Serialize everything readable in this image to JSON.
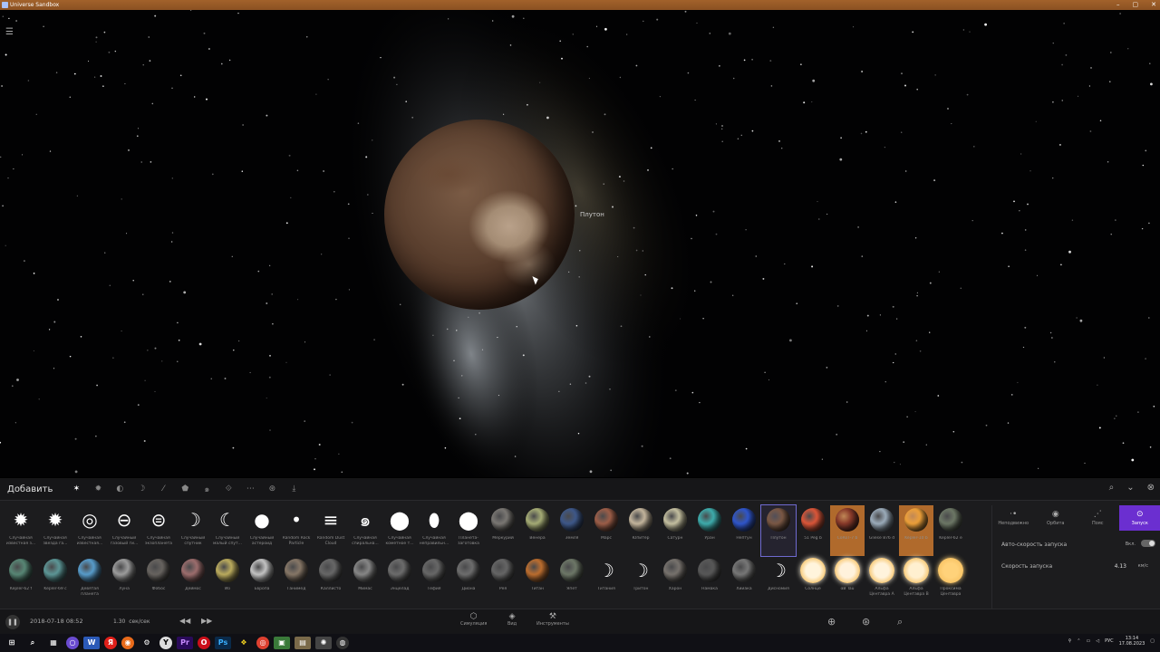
{
  "window": {
    "title": "Universe Sandbox",
    "min": "–",
    "max": "▢",
    "close": "✕"
  },
  "scene": {
    "planet_label": "Плутон"
  },
  "panel": {
    "add_label": "Добавить",
    "row1": [
      {
        "label": "Случайная известная з...",
        "kind": "glyph",
        "glyph": "✹"
      },
      {
        "label": "Случайная звезда га...",
        "kind": "glyph",
        "glyph": "✹"
      },
      {
        "label": "Случайная известная...",
        "kind": "glyph",
        "glyph": "◎"
      },
      {
        "label": "Случайный газовый ги...",
        "kind": "glyph",
        "glyph": "⊖"
      },
      {
        "label": "Случайная экзопланета",
        "kind": "glyph",
        "glyph": "⊜"
      },
      {
        "label": "Случайный спутник",
        "kind": "glyph",
        "glyph": "☽"
      },
      {
        "label": "Случайный малый спут...",
        "kind": "glyph",
        "glyph": "☾"
      },
      {
        "label": "Случайный астероид",
        "kind": "glyph",
        "glyph": "●"
      },
      {
        "label": "Random Rock Particle",
        "kind": "glyph",
        "glyph": "•"
      },
      {
        "label": "Random Dust Cloud",
        "kind": "glyph",
        "glyph": "≡"
      },
      {
        "label": "Случайная спиральна...",
        "kind": "glyph",
        "glyph": "๑"
      },
      {
        "label": "Случайная кометное т...",
        "kind": "glyph",
        "glyph": "⬤"
      },
      {
        "label": "Случайная неправильн...",
        "kind": "glyph",
        "glyph": "⬮"
      },
      {
        "label": "Планета-заготовка",
        "kind": "glyph",
        "glyph": "⬤"
      },
      {
        "label": "Меркурий",
        "kind": "ball",
        "color": "#7d7a76"
      },
      {
        "label": "Венера",
        "kind": "ball",
        "color": "#a9b078"
      },
      {
        "label": "Земля",
        "kind": "ball",
        "color": "#3f5a8c"
      },
      {
        "label": "Марс",
        "kind": "ball",
        "color": "#a0604a"
      },
      {
        "label": "Юпитер",
        "kind": "ball",
        "color": "#c8b9a0"
      },
      {
        "label": "Сатурн",
        "kind": "ball",
        "color": "#c9c4a4"
      },
      {
        "label": "Уран",
        "kind": "ball",
        "color": "#3fb0b0"
      },
      {
        "label": "Нептун",
        "kind": "ball",
        "color": "#3058d0"
      },
      {
        "label": "Плутон",
        "kind": "ball",
        "color": "#7d5a46",
        "selected": true
      },
      {
        "label": "51 Peg b",
        "kind": "ball",
        "color": "#e0583a"
      },
      {
        "label": "CoRoT-7 b",
        "kind": "ball",
        "color": "#8a3a2a",
        "highlight": true
      },
      {
        "label": "Gliese 876 d",
        "kind": "ball",
        "color": "#9fb0bf"
      },
      {
        "label": "Kepler-10 b",
        "kind": "ball",
        "color": "#f0a23a",
        "highlight": true
      },
      {
        "label": "Kepler-62 e",
        "kind": "ball",
        "color": "#6f7a68"
      }
    ],
    "row2": [
      {
        "label": "Kepler-62 f",
        "kind": "ball",
        "color": "#5a8a78"
      },
      {
        "label": "Kepler-69 c",
        "kind": "ball",
        "color": "#5f9a9a"
      },
      {
        "label": "Девятая планета",
        "kind": "ball",
        "color": "#5aa0d0"
      },
      {
        "label": "Луна",
        "kind": "ball",
        "color": "#a0a0a0"
      },
      {
        "label": "Фобос",
        "kind": "ball",
        "color": "#6a6662"
      },
      {
        "label": "Деймос",
        "kind": "ball",
        "color": "#a07070"
      },
      {
        "label": "Ио",
        "kind": "ball",
        "color": "#c0b060"
      },
      {
        "label": "Европа",
        "kind": "ball",
        "color": "#c8c8c8"
      },
      {
        "label": "Ганимед",
        "kind": "ball",
        "color": "#8a7a6a"
      },
      {
        "label": "Каллисто",
        "kind": "ball",
        "color": "#6a6a6a"
      },
      {
        "label": "Мимас",
        "kind": "ball",
        "color": "#8a8a8a"
      },
      {
        "label": "Энцелад",
        "kind": "ball",
        "color": "#6f6f6f"
      },
      {
        "label": "Тефия",
        "kind": "ball",
        "color": "#6a6a6a"
      },
      {
        "label": "Диона",
        "kind": "ball",
        "color": "#707070"
      },
      {
        "label": "Рея",
        "kind": "ball",
        "color": "#686868"
      },
      {
        "label": "Титан",
        "kind": "ball",
        "color": "#c07030"
      },
      {
        "label": "Япет",
        "kind": "ball",
        "color": "#707a6a"
      },
      {
        "label": "Титания",
        "kind": "glyph",
        "glyph": "☽"
      },
      {
        "label": "Тритон",
        "kind": "glyph",
        "glyph": "☽"
      },
      {
        "label": "Харон",
        "kind": "ball",
        "color": "#7a7570"
      },
      {
        "label": "Намака",
        "kind": "ball",
        "color": "#5a5a5a"
      },
      {
        "label": "Хииака",
        "kind": "ball",
        "color": "#7a7a7a"
      },
      {
        "label": "Дисномия",
        "kind": "glyph",
        "glyph": "☽"
      },
      {
        "label": "Солнце",
        "kind": "star",
        "color": "#fff4dc"
      },
      {
        "label": "αB Tau",
        "kind": "star",
        "color": "#fff2dc"
      },
      {
        "label": "Альфа Центавра A",
        "kind": "star",
        "color": "#fff3dc"
      },
      {
        "label": "Альфа Центавра B",
        "kind": "star",
        "color": "#fff0d0"
      },
      {
        "label": "Проксима Центавра",
        "kind": "star",
        "color": "#ffd27a"
      }
    ]
  },
  "side": {
    "tabs": [
      {
        "label": "Неподвижно",
        "icon": "⋅•"
      },
      {
        "label": "Орбита",
        "icon": "◉"
      },
      {
        "label": "Пояс",
        "icon": "⋰"
      },
      {
        "label": "Запуск",
        "icon": "⊙",
        "active": true
      }
    ],
    "auto_speed_label": "Авто-скорость запуска",
    "auto_speed_value": "Вкл.",
    "speed_label": "Скорость запуска",
    "speed_value": "4.13",
    "speed_unit": "км/с"
  },
  "bottom": {
    "datetime": "2018-07-18 08:52",
    "speed_value": "1.30",
    "speed_unit": "сек/сек",
    "tabs": [
      {
        "label": "Симуляция",
        "icon": "⬡"
      },
      {
        "label": "Вид",
        "icon": "◈"
      },
      {
        "label": "Инструменты",
        "icon": "⚒"
      }
    ]
  },
  "taskbar": {
    "lang": "РУС",
    "time": "13:14",
    "date": "17.08.2023"
  }
}
